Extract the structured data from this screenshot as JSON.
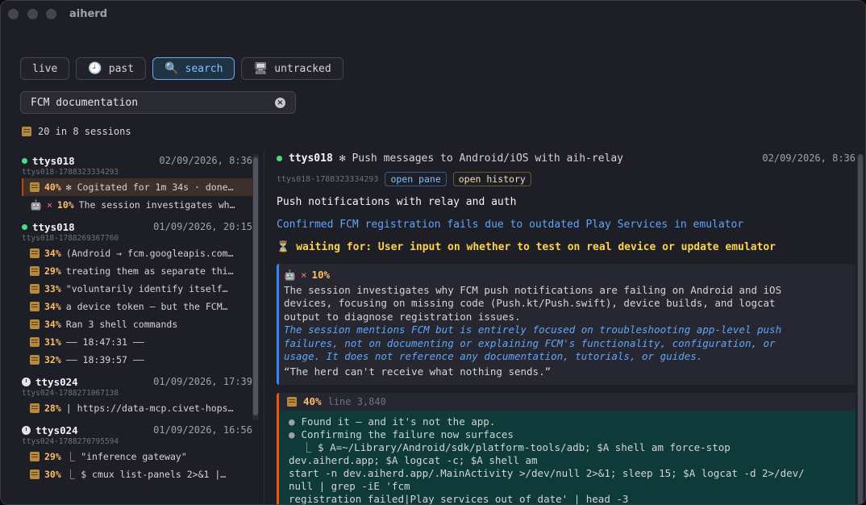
{
  "app": {
    "title": "aiherd"
  },
  "tabs": [
    {
      "label": "live",
      "icon": ""
    },
    {
      "label": "past",
      "icon": "clock-icon"
    },
    {
      "label": "search",
      "icon": "magnifier-icon"
    },
    {
      "label": "untracked",
      "icon": "monitor-icon"
    }
  ],
  "active_tab": "search",
  "search": {
    "value": "FCM documentation",
    "clear_icon": "clear-icon"
  },
  "summary": {
    "text": "20 in 8 sessions"
  },
  "sessions": [
    {
      "name": "ttys018",
      "date": "02/09/2026, 8:36",
      "id": "ttys018-1788323334293",
      "status": "live",
      "hits": [
        {
          "pct": "40%",
          "text": "✻ Cogitated for 1m 34s · done…",
          "icon": "scroll-icon",
          "selected": true
        },
        {
          "pct": "10%",
          "text": "The session investigates wh…",
          "icon": "robot-icon",
          "prefix": "×"
        }
      ]
    },
    {
      "name": "ttys018",
      "date": "01/09/2026, 20:15",
      "id": "ttys018-1788269367760",
      "status": "live",
      "hits": [
        {
          "pct": "34%",
          "text": "(Android → fcm.googleapis.com…"
        },
        {
          "pct": "29%",
          "text": "treating them as separate thi…"
        },
        {
          "pct": "33%",
          "text": "\"voluntarily identify itself…"
        },
        {
          "pct": "34%",
          "text": "a device token — but the FCM…"
        },
        {
          "pct": "34%",
          "text": "Ran 3 shell commands"
        },
        {
          "pct": "31%",
          "text": "—— 18:47:31 ——"
        },
        {
          "pct": "32%",
          "text": "—— 18:39:57 ——"
        }
      ]
    },
    {
      "name": "ttys024",
      "date": "01/09/2026, 17:39",
      "id": "ttys024-1788271067138",
      "status": "past",
      "hits": [
        {
          "pct": "28%",
          "text": "| https://data-mcp.civet-hops…"
        }
      ]
    },
    {
      "name": "ttys024",
      "date": "01/09/2026, 16:56",
      "id": "ttys024-1788270795594",
      "status": "past",
      "hits": [
        {
          "pct": "29%",
          "text": "⎿ \"inference gateway\""
        },
        {
          "pct": "30%",
          "text": "⎿ $ cmux list-panels 2>&1 |…"
        }
      ]
    }
  ],
  "detail": {
    "name": "ttys018",
    "title": "✻ Push messages to Android/iOS with aih-relay",
    "date": "02/09/2026, 8:36",
    "id": "ttys018-1788323334293",
    "open_pane": "open pane",
    "open_history": "open history",
    "subtitle": "Push notifications with relay and auth",
    "summary": "Confirmed FCM registration fails due to outdated Play Services in emulator",
    "wait_icon": "hourglass-icon",
    "waiting": "waiting for: User input on whether to test on real device or update emulator",
    "ai_card": {
      "pct": "10%",
      "desc_lines": [
        "The session investigates why FCM push notifications are failing on Android and iOS",
        "devices, focusing on missing code (Push.kt/Push.swift), device builds, and logcat",
        "output to diagnose registration issues."
      ],
      "note_lines": [
        "The session mentions FCM but is entirely focused on troubleshooting app-level push",
        "failures, not on documenting or explaining FCM's functionality, configuration, or",
        "usage. It does not reference any documentation, tutorials, or guides."
      ],
      "quote": "“The herd can't receive what nothing sends.”"
    },
    "hit_card": {
      "pct": "40%",
      "line": "line 3,840",
      "bullets": [
        "Found it — and it's not the app.",
        "Confirming the failure now surfaces"
      ],
      "cmd_lines": [
        "⎿  $ A=~/Library/Android/sdk/platform-tools/adb; $A shell am force-stop",
        "dev.aiherd.app; $A logcat -c; $A shell am",
        "start -n dev.aiherd.app/.MainActivity >/dev/null 2>&1; sleep 15; $A logcat -d 2>/dev/",
        "null | grep -iE 'fcm",
        "registration failed|Play services out of date' | head -3"
      ]
    }
  }
}
